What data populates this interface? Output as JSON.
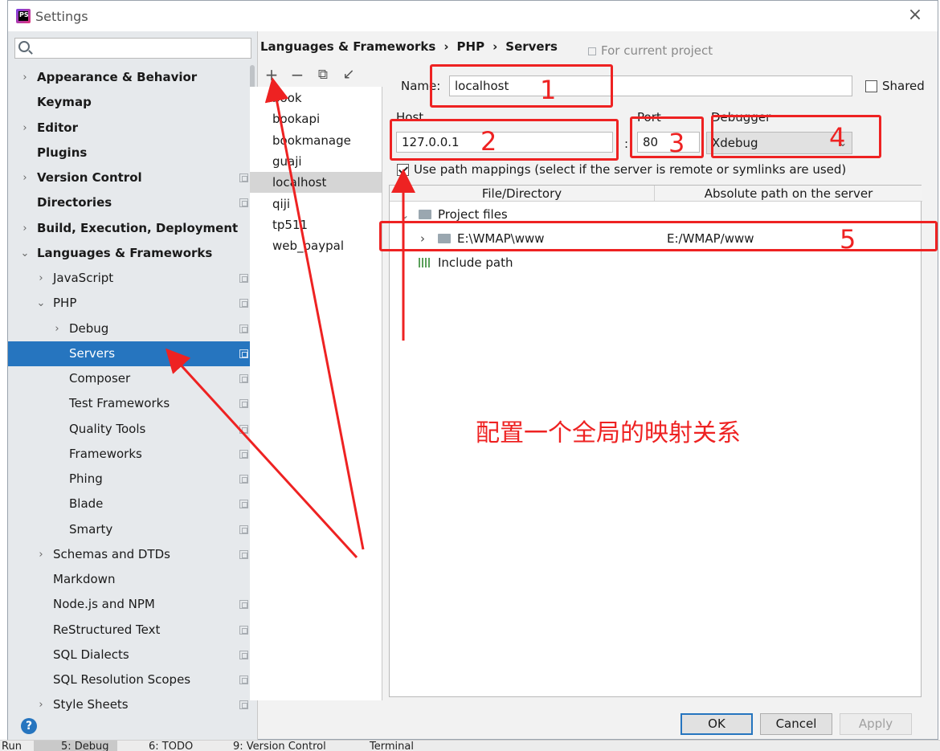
{
  "window": {
    "title": "Settings"
  },
  "search": {
    "placeholder": ""
  },
  "sidebar": {
    "items": [
      {
        "label": "Appearance & Behavior",
        "chevron": "›",
        "bold": true
      },
      {
        "label": "Keymap",
        "chevron": "",
        "bold": true
      },
      {
        "label": "Editor",
        "chevron": "›",
        "bold": true
      },
      {
        "label": "Plugins",
        "chevron": "",
        "bold": true
      },
      {
        "label": "Version Control",
        "chevron": "›",
        "bold": true
      },
      {
        "label": "Directories",
        "chevron": "",
        "bold": true
      },
      {
        "label": "Build, Execution, Deployment",
        "chevron": "›",
        "bold": true
      },
      {
        "label": "Languages & Frameworks",
        "chevron": "⌄",
        "bold": true
      },
      {
        "label": "JavaScript",
        "chevron": "›"
      },
      {
        "label": "PHP",
        "chevron": "⌄"
      },
      {
        "label": "Debug",
        "chevron": "›"
      },
      {
        "label": "Servers",
        "chevron": "",
        "selected": true
      },
      {
        "label": "Composer",
        "chevron": ""
      },
      {
        "label": "Test Frameworks",
        "chevron": ""
      },
      {
        "label": "Quality Tools",
        "chevron": ""
      },
      {
        "label": "Frameworks",
        "chevron": ""
      },
      {
        "label": "Phing",
        "chevron": ""
      },
      {
        "label": "Blade",
        "chevron": ""
      },
      {
        "label": "Smarty",
        "chevron": ""
      },
      {
        "label": "Schemas and DTDs",
        "chevron": "›"
      },
      {
        "label": "Markdown",
        "chevron": ""
      },
      {
        "label": "Node.js and NPM",
        "chevron": ""
      },
      {
        "label": "ReStructured Text",
        "chevron": ""
      },
      {
        "label": "SQL Dialects",
        "chevron": ""
      },
      {
        "label": "SQL Resolution Scopes",
        "chevron": ""
      },
      {
        "label": "Style Sheets",
        "chevron": "›"
      }
    ]
  },
  "breadcrumb": {
    "part1": "Languages & Frameworks",
    "part2": "PHP",
    "part3": "Servers",
    "sep": "›"
  },
  "for_project": "For current project",
  "toolbar": {
    "add": "+",
    "remove": "−",
    "copy": "⧉",
    "import": "↙"
  },
  "servers": [
    "book",
    "bookapi",
    "bookmanage",
    "guaji",
    "localhost",
    "qiji",
    "tp511",
    "web_paypal"
  ],
  "selected_server": "localhost",
  "form": {
    "name_label": "Name:",
    "name_value": "localhost",
    "shared_label": "Shared",
    "host_label": "Host",
    "host_value": "127.0.0.1",
    "colon": ":",
    "port_label": "Port",
    "port_value": "80",
    "debugger_label": "Debugger",
    "debugger_value": "Xdebug",
    "path_mappings_label": "Use path mappings (select if the server is remote or symlinks are used)"
  },
  "mappings": {
    "col1": "File/Directory",
    "col2": "Absolute path on the server",
    "project_files": "Project files",
    "local_path": "E:\\WMAP\\www",
    "server_path": "E:/WMAP/www",
    "include_path": "Include path"
  },
  "buttons": {
    "ok": "OK",
    "cancel": "Cancel",
    "apply": "Apply",
    "help": "?"
  },
  "annotations": {
    "n1": "1",
    "n2": "2",
    "n3": "3",
    "n4": "4",
    "n5": "5",
    "text": "配置一个全局的映射关系"
  },
  "background_tabs": {
    "run": "Run",
    "debug": "5: Debug",
    "todo": "6: TODO",
    "vcs": "9: Version Control",
    "terminal": "Terminal"
  },
  "colors": {
    "accent": "#2675bf",
    "annotation": "#ee2222"
  }
}
